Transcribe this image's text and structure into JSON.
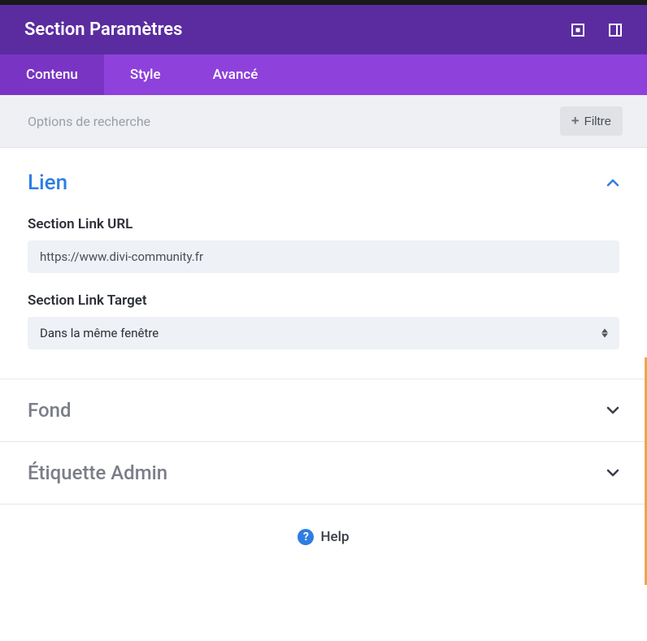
{
  "header": {
    "title": "Section Paramètres"
  },
  "tabs": {
    "content": "Contenu",
    "style": "Style",
    "advanced": "Avancé"
  },
  "search": {
    "placeholder": "Options de recherche",
    "filter_label": "Filtre"
  },
  "sections": {
    "lien": {
      "title": "Lien",
      "link_url_label": "Section Link URL",
      "link_url_value": "https://www.divi-community.fr",
      "link_target_label": "Section Link Target",
      "link_target_value": "Dans la même fenêtre"
    },
    "fond": {
      "title": "Fond"
    },
    "etiquette": {
      "title": "Étiquette Admin"
    }
  },
  "help": {
    "label": "Help"
  }
}
